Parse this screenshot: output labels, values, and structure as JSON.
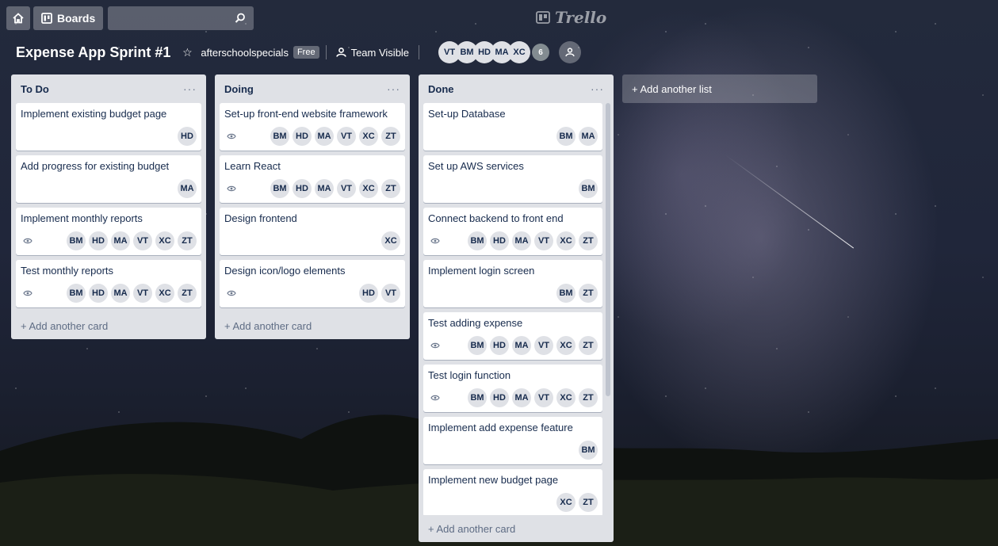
{
  "topbar": {
    "boards_label": "Boards",
    "search_value": "",
    "logo_text": "Trello"
  },
  "board": {
    "title": "Expense App Sprint #1",
    "team": "afterschoolspecials",
    "team_badge": "Free",
    "visibility": "Team Visible",
    "members": [
      "VT",
      "BM",
      "HD",
      "MA",
      "XC"
    ],
    "member_count": "6"
  },
  "add_list_label": "+ Add another list",
  "lists": [
    {
      "title": "To Do",
      "add_label": "+ Add another card",
      "cards": [
        {
          "title": "Implement existing budget page",
          "watch": false,
          "members": [
            "HD"
          ]
        },
        {
          "title": "Add progress for existing budget",
          "watch": false,
          "members": [
            "MA"
          ]
        },
        {
          "title": "Implement monthly reports",
          "watch": true,
          "members": [
            "BM",
            "HD",
            "MA",
            "VT",
            "XC",
            "ZT"
          ]
        },
        {
          "title": "Test monthly reports",
          "watch": true,
          "members": [
            "BM",
            "HD",
            "MA",
            "VT",
            "XC",
            "ZT"
          ]
        }
      ]
    },
    {
      "title": "Doing",
      "add_label": "+ Add another card",
      "cards": [
        {
          "title": "Set-up front-end website framework",
          "watch": true,
          "members": [
            "BM",
            "HD",
            "MA",
            "VT",
            "XC",
            "ZT"
          ]
        },
        {
          "title": "Learn React",
          "watch": true,
          "members": [
            "BM",
            "HD",
            "MA",
            "VT",
            "XC",
            "ZT"
          ]
        },
        {
          "title": "Design frontend",
          "watch": false,
          "members": [
            "XC"
          ]
        },
        {
          "title": "Design icon/logo elements",
          "watch": true,
          "members": [
            "HD",
            "VT"
          ]
        }
      ]
    },
    {
      "title": "Done",
      "add_label": "+ Add another card",
      "cards": [
        {
          "title": "Set-up Database",
          "watch": false,
          "members": [
            "BM",
            "MA"
          ]
        },
        {
          "title": "Set up AWS services",
          "watch": false,
          "members": [
            "BM"
          ]
        },
        {
          "title": "Connect backend to front end",
          "watch": true,
          "members": [
            "BM",
            "HD",
            "MA",
            "VT",
            "XC",
            "ZT"
          ]
        },
        {
          "title": "Implement login screen",
          "watch": false,
          "members": [
            "BM",
            "ZT"
          ]
        },
        {
          "title": "Test adding expense",
          "watch": true,
          "members": [
            "BM",
            "HD",
            "MA",
            "VT",
            "XC",
            "ZT"
          ]
        },
        {
          "title": "Test login function",
          "watch": true,
          "members": [
            "BM",
            "HD",
            "MA",
            "VT",
            "XC",
            "ZT"
          ]
        },
        {
          "title": "Implement add expense feature",
          "watch": false,
          "members": [
            "BM"
          ]
        },
        {
          "title": "Implement new budget page",
          "watch": false,
          "members": [
            "XC",
            "ZT"
          ]
        }
      ]
    }
  ],
  "colors": {
    "list_bg": "#dfe1e6",
    "card_bg": "#ffffff",
    "text": "#172b4d",
    "muted": "#5e6c84"
  }
}
